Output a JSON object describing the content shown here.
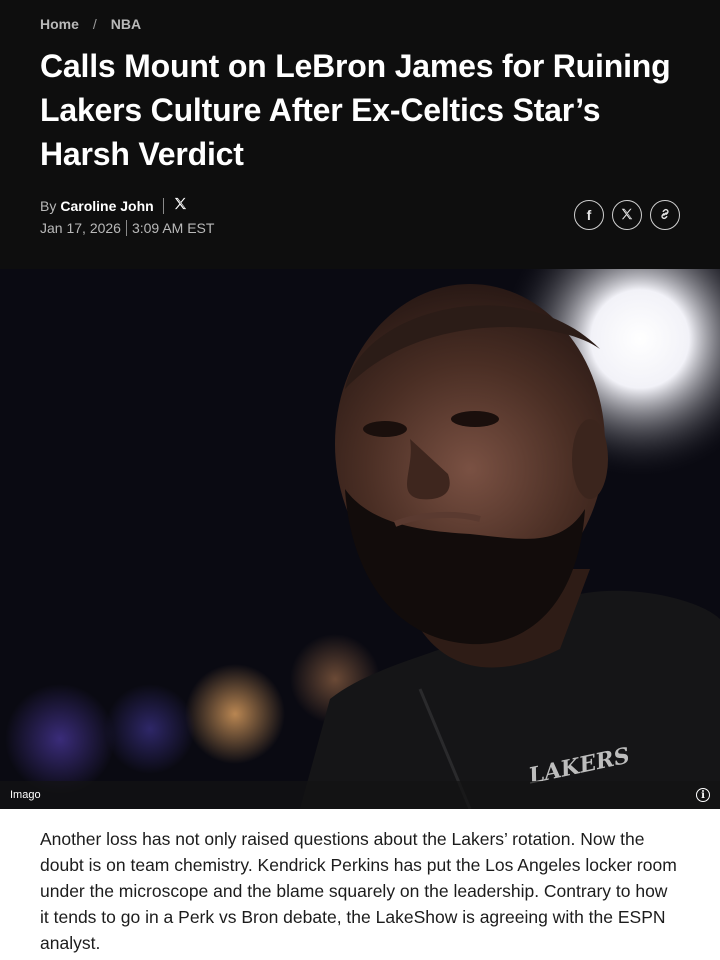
{
  "breadcrumb": {
    "items": [
      "Home",
      "NBA"
    ],
    "separator": "/"
  },
  "article": {
    "headline": "Calls Mount on LeBron James for Ruining Lakers Culture After Ex-Celtics Star’s Harsh Verdict",
    "byline_prefix": "By",
    "author": "Caroline John",
    "author_social_icon": "x-logo-icon",
    "date": "Jan 17, 2026",
    "time": "3:09 AM EST",
    "share_buttons": [
      {
        "icon": "facebook-icon",
        "glyph": "f"
      },
      {
        "icon": "x-icon",
        "glyph": "𝕏"
      },
      {
        "icon": "link-icon",
        "glyph": "🔗"
      }
    ],
    "image_credit": "Imago",
    "image_info_glyph": "i",
    "jersey_text": "LAKERS",
    "body": "Another loss has not only raised questions about the Lakers’ rotation. Now the doubt is on team chemistry. Kendrick Perkins has put the Los Angeles locker room under the microscope and the blame squarely on the leadership. Contrary to how it tends to go in a Perk vs Bron debate, the LakeShow is agreeing with the ESPN analyst."
  },
  "colors": {
    "header_bg": "#0e0e0e",
    "headline": "#ffffff",
    "meta_text": "#b9b9b9",
    "body_text": "#1c1c1c"
  }
}
